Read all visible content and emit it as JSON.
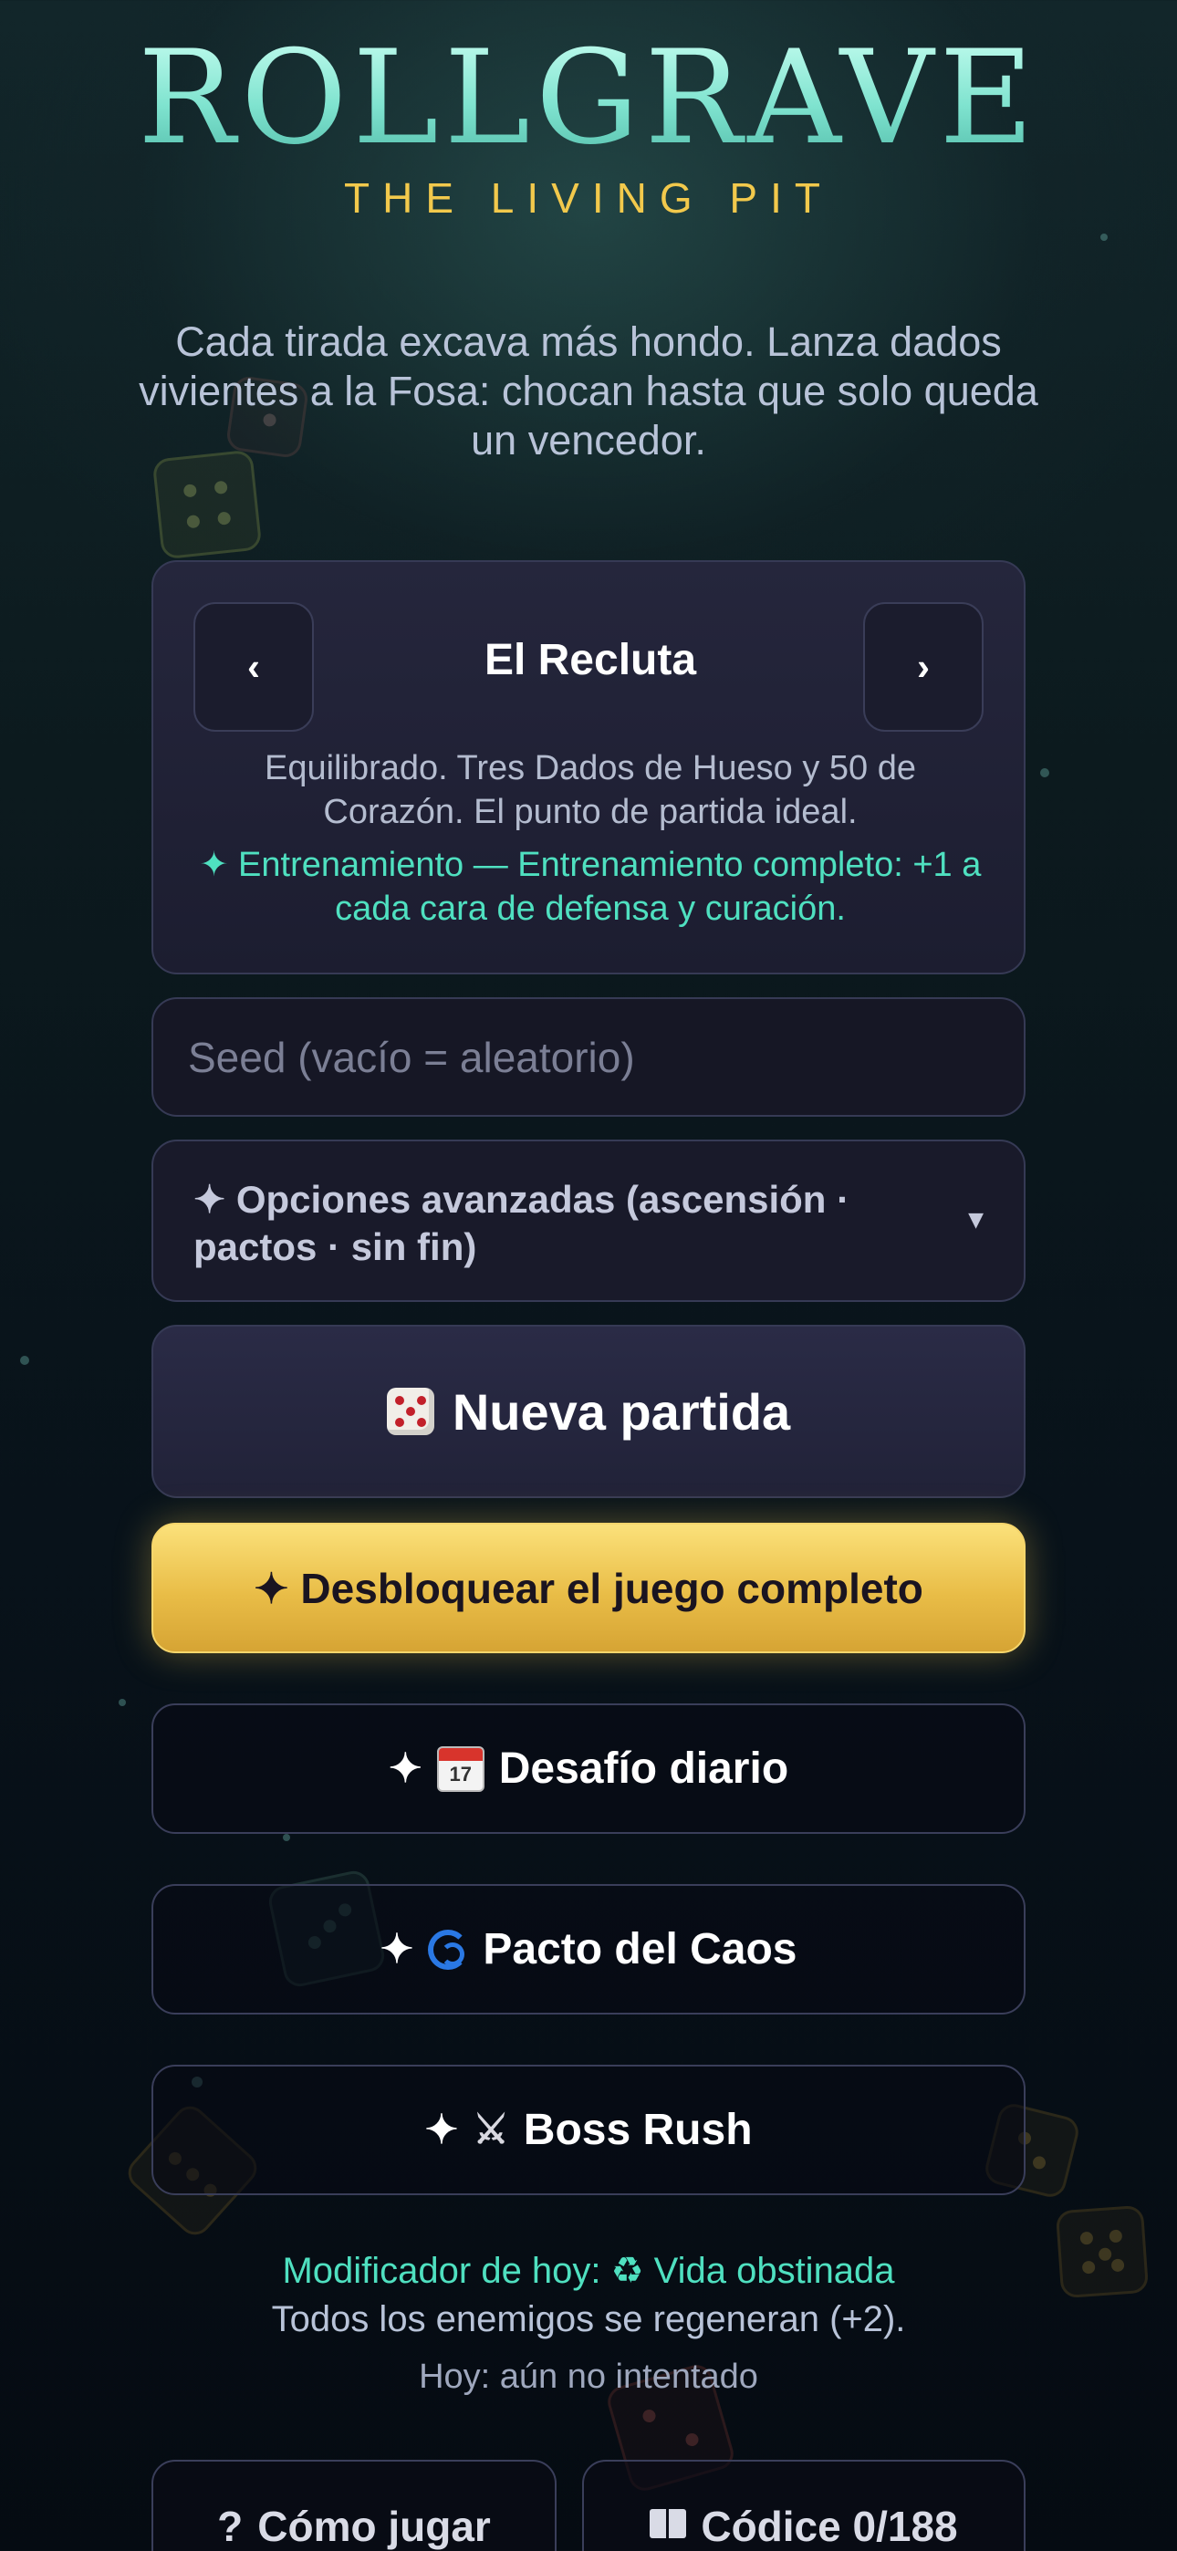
{
  "app": {
    "title": "ROLLGRAVE",
    "subtitle": "THE LIVING PIT",
    "intro": "Cada tirada excava más hondo. Lanza dados vivientes a la Fosa: chocan hasta que solo queda un vencedor."
  },
  "hero": {
    "prev_label": "‹",
    "next_label": "›",
    "name": "El Recluta",
    "description": "Equilibrado. Tres Dados de Hueso y 50 de Corazón. El punto de partida ideal.",
    "perk": "✦ Entrenamiento — Entrenamiento completo: +1 a cada cara de defensa y curación."
  },
  "seed": {
    "placeholder": "Seed (vacío = aleatorio)",
    "value": ""
  },
  "advanced": {
    "label": "✦ Opciones avanzadas (ascensión · pactos · sin fin)",
    "caret": "▼"
  },
  "actions": {
    "new_game": {
      "icon": "die-icon",
      "label": "Nueva partida"
    },
    "unlock": {
      "label": "✦ Desbloquear el juego completo"
    },
    "daily": {
      "prefix": "✦",
      "icon": "calendar-icon",
      "label": "Desafío diario",
      "calendar_day": "17"
    },
    "chaos": {
      "prefix": "✦",
      "icon": "cyclone-icon",
      "label": "Pacto del Caos"
    },
    "boss": {
      "prefix": "✦",
      "icon": "crossed-swords-icon",
      "swords": "⚔",
      "label": "Boss Rush"
    }
  },
  "daily_modifier": {
    "title": "Modificador de hoy: ♻ Vida obstinada",
    "description": "Todos los enemigos se regeneran (+2).",
    "status": "Hoy: aún no intentado"
  },
  "bottom": {
    "howto": {
      "icon": "question-icon",
      "glyph": "?",
      "label": "Cómo jugar"
    },
    "codex": {
      "icon": "book-icon",
      "label": "Códice 0/188"
    }
  },
  "colors": {
    "accent_teal": "#4fe0c0",
    "gold": "#f2c94c",
    "title_mint": "#9ff0df"
  }
}
